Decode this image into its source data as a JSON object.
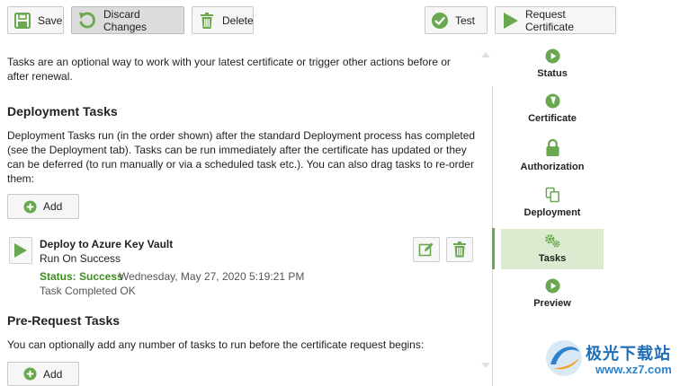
{
  "toolbar": {
    "save": "Save",
    "discard": "Discard Changes",
    "delete": "Delete",
    "test": "Test",
    "request_certificate": "Request Certificate"
  },
  "intro": "Tasks are an optional way to work with your latest certificate or trigger other actions before or after renewal.",
  "deployment": {
    "heading": "Deployment Tasks",
    "description": "Deployment Tasks run (in the order shown) after the standard Deployment process has completed (see the Deployment tab). Tasks can be run immediately after the certificate has updated or they can be deferred (to run manually or via a scheduled task etc.). You can also drag tasks to re-order them:",
    "add_label": "Add",
    "task": {
      "title": "Deploy to Azure Key Vault",
      "trigger": "Run On Success",
      "status": "Status: Success",
      "timestamp": "Wednesday, May 27, 2020 5:19:21 PM",
      "result": "Task Completed OK"
    }
  },
  "prerequest": {
    "heading": "Pre-Request Tasks",
    "description": "You can optionally add any number of tasks to run before the certificate request begins:",
    "add_label": "Add"
  },
  "nav": {
    "status": "Status",
    "certificate": "Certificate",
    "authorization": "Authorization",
    "deployment": "Deployment",
    "tasks": "Tasks",
    "preview": "Preview"
  },
  "watermark": {
    "title": "极光下载站",
    "url": "www.xz7.com"
  },
  "colors": {
    "accent_green": "#6aa84f",
    "status_green": "#3e8e1f",
    "active_nav_bg": "#dcebd0"
  }
}
